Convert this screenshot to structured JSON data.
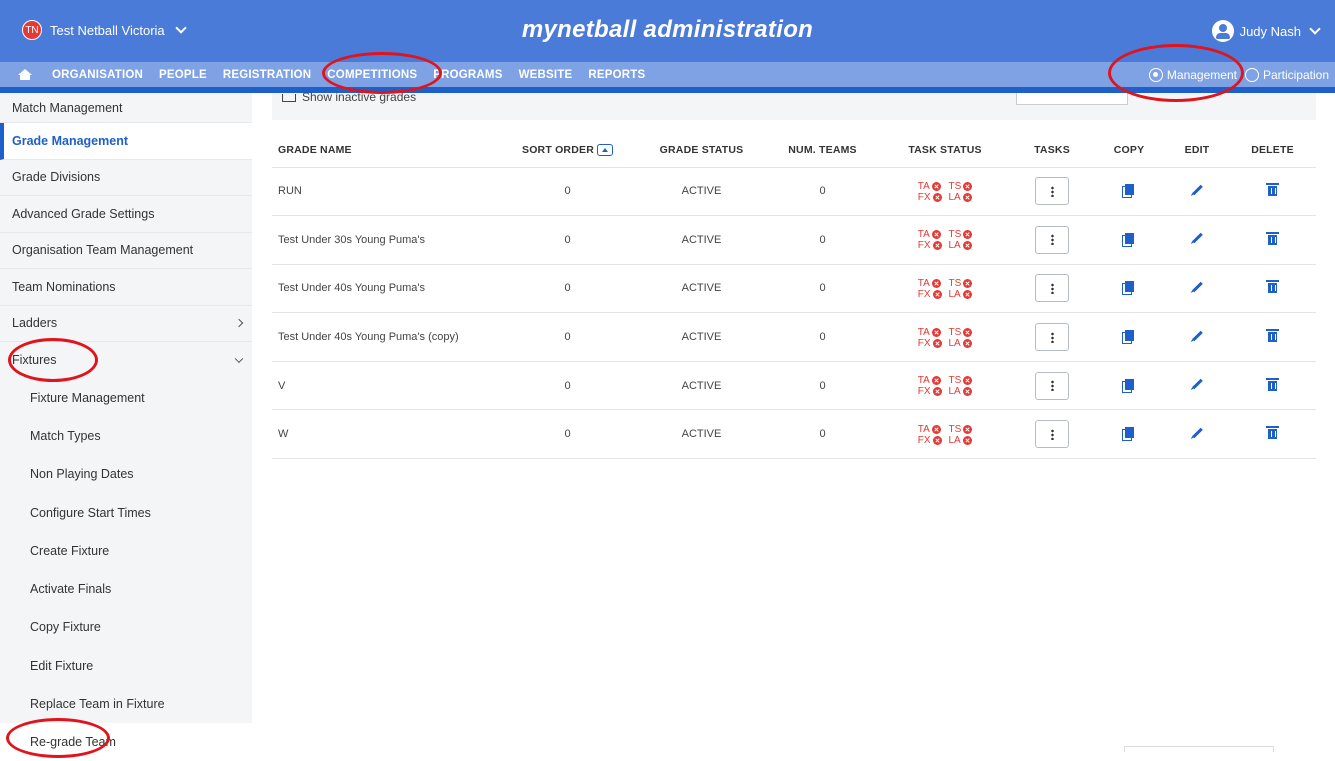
{
  "header": {
    "org_initials": "TN",
    "org_name": "Test Netball Victoria",
    "app_title": "mynetball administration",
    "user_name": "Judy Nash"
  },
  "nav": {
    "items": [
      "ORGANISATION",
      "PEOPLE",
      "REGISTRATION",
      "COMPETITIONS",
      "PROGRAMS",
      "WEBSITE",
      "REPORTS"
    ],
    "active": "COMPETITIONS",
    "mode_management": "Management",
    "mode_participation": "Participation",
    "selected_mode": "Management"
  },
  "sidebar": {
    "items": [
      {
        "label": "Match Management"
      },
      {
        "label": "Grade Management",
        "active": true
      },
      {
        "label": "Grade Divisions"
      },
      {
        "label": "Advanced Grade Settings"
      },
      {
        "label": "Organisation Team Management"
      },
      {
        "label": "Team Nominations"
      },
      {
        "label": "Ladders",
        "arrow": "right"
      },
      {
        "label": "Fixtures",
        "arrow": "down"
      }
    ],
    "sub_items": [
      "Fixture Management",
      "Match Types",
      "Non Playing Dates",
      "Configure Start Times",
      "Create Fixture",
      "Activate Finals",
      "Copy Fixture",
      "Edit Fixture",
      "Replace Team in Fixture",
      "Re-grade Team"
    ]
  },
  "filters": {
    "show_inactive_label": "Show inactive grades"
  },
  "table": {
    "headers": {
      "grade_name": "GRADE NAME",
      "sort_order": "SORT ORDER",
      "grade_status": "GRADE STATUS",
      "num_teams": "NUM. TEAMS",
      "task_status": "TASK STATUS",
      "tasks": "TASKS",
      "copy": "COPY",
      "edit": "EDIT",
      "delete": "DELETE"
    },
    "task_codes": [
      "TA",
      "TS",
      "FX",
      "LA"
    ],
    "rows": [
      {
        "grade_name": "RUN",
        "sort_order": "0",
        "grade_status": "ACTIVE",
        "num_teams": "0"
      },
      {
        "grade_name": "Test Under 30s Young Puma's",
        "sort_order": "0",
        "grade_status": "ACTIVE",
        "num_teams": "0"
      },
      {
        "grade_name": "Test Under 40s Young Puma's",
        "sort_order": "0",
        "grade_status": "ACTIVE",
        "num_teams": "0"
      },
      {
        "grade_name": "Test Under 40s Young Puma's (copy)",
        "sort_order": "0",
        "grade_status": "ACTIVE",
        "num_teams": "0"
      },
      {
        "grade_name": "V",
        "sort_order": "0",
        "grade_status": "ACTIVE",
        "num_teams": "0"
      },
      {
        "grade_name": "W",
        "sort_order": "0",
        "grade_status": "ACTIVE",
        "num_teams": "0"
      }
    ]
  },
  "colors": {
    "header_bg": "#4b7bd9",
    "nav_bg": "#7ea2e3",
    "accent": "#1f5fc9",
    "status_red": "#e53935",
    "annotation_red": "#e0141c"
  }
}
